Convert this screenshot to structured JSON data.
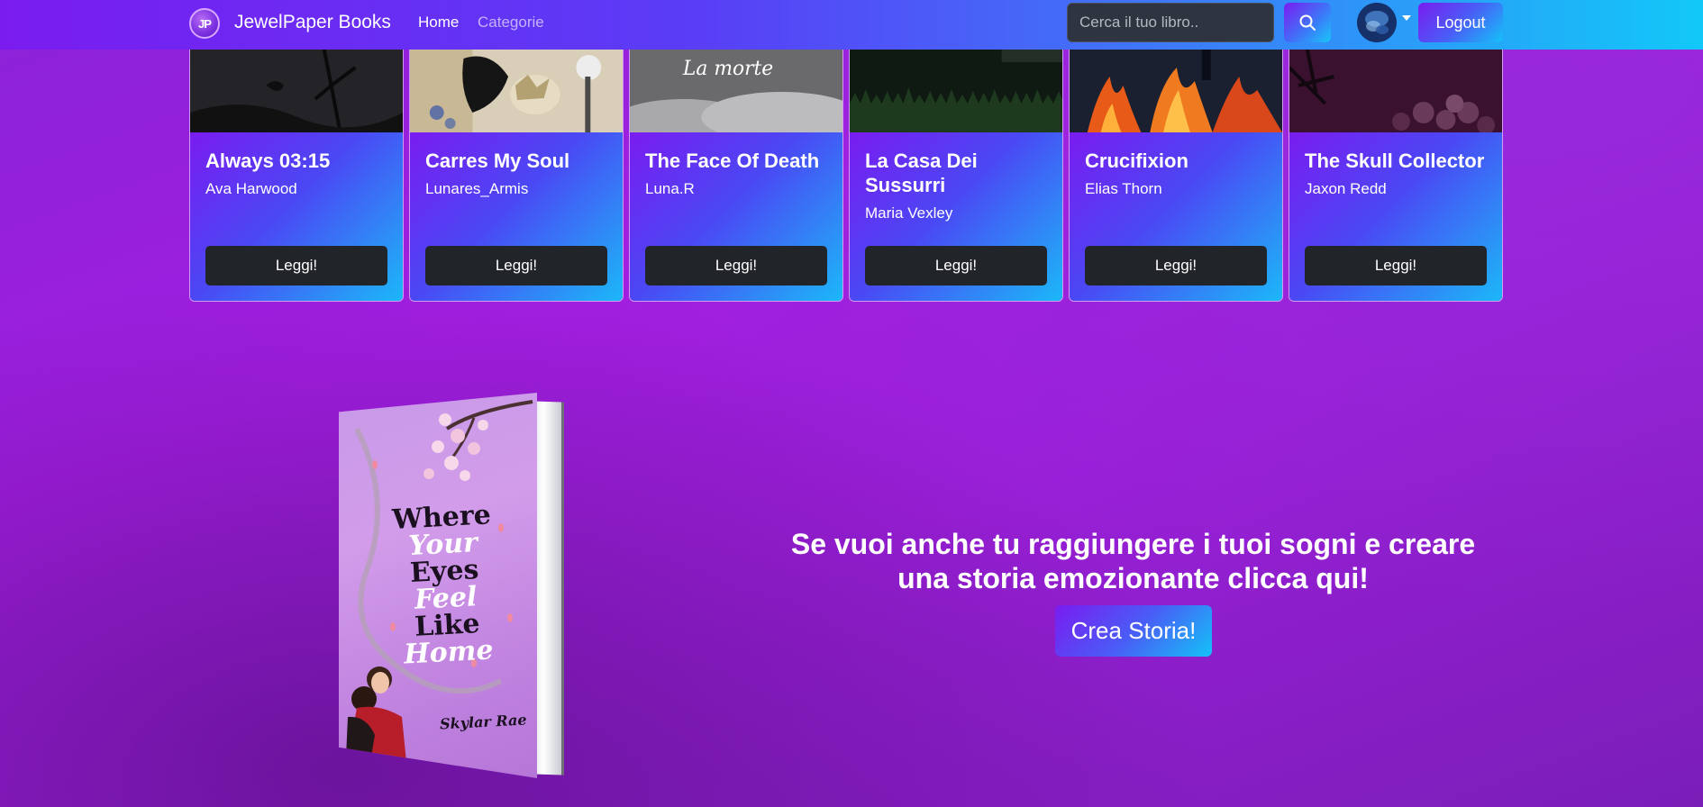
{
  "navbar": {
    "logo_text": "JP",
    "brand": "JewelPaper Books",
    "links": [
      "Home",
      "Categorie"
    ],
    "search_placeholder": "Cerca il tuo libro..",
    "logout_label": "Logout"
  },
  "books": [
    {
      "title": "Always 03:15",
      "author": "Ava Harwood",
      "button": "Leggi!",
      "image_text": ""
    },
    {
      "title": "Carres My Soul",
      "author": "Lunares_Armis",
      "button": "Leggi!",
      "image_text": ""
    },
    {
      "title": "The Face Of Death",
      "author": "Luna.R",
      "button": "Leggi!",
      "image_text": "La morte"
    },
    {
      "title": "La Casa Dei Sussurri",
      "author": "Maria Vexley",
      "button": "Leggi!",
      "image_text": ""
    },
    {
      "title": "Crucifixion",
      "author": "Elias Thorn",
      "button": "Leggi!",
      "image_text": ""
    },
    {
      "title": "The Skull Collector",
      "author": "Jaxon Redd",
      "button": "Leggi!",
      "image_text": ""
    }
  ],
  "promo": {
    "text": "Se vuoi anche tu raggiungere i tuoi sogni e creare una storia emozionante clicca qui!",
    "button": "Crea Storia!"
  },
  "featured_book": {
    "title_lines": [
      "Where",
      "Your",
      "Eyes",
      "Feel",
      "Like",
      "Home"
    ],
    "author": "Skylar Rae"
  },
  "colors": {
    "nav_gradient_start": "#7a1cf0",
    "nav_gradient_end": "#12c8f8",
    "page_background": "#a21ee0",
    "button_dark": "#212529"
  }
}
